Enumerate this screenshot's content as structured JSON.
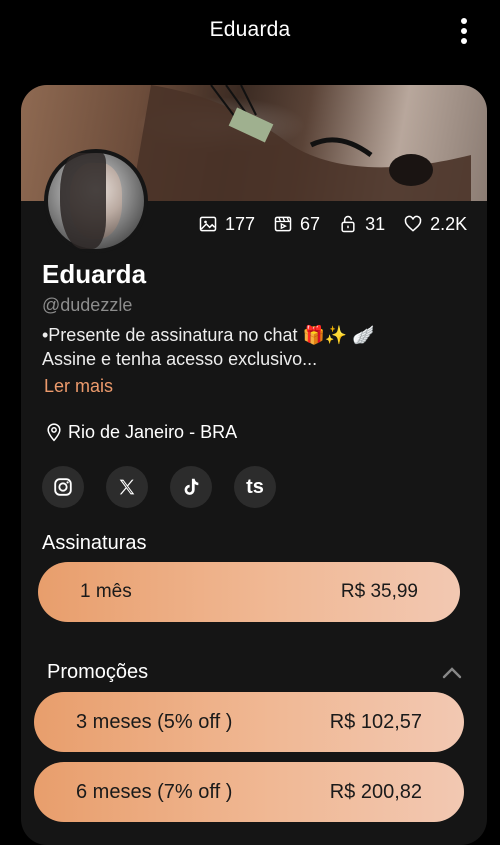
{
  "header": {
    "title": "Eduarda",
    "menu_icon": "more-vertical-icon"
  },
  "profile": {
    "name": "Eduarda",
    "handle": "@dudezzle",
    "bio_line1": "•Presente de assinatura no chat 🎁✨ 🪽",
    "bio_line2": "Assine e tenha acesso exclusivo...",
    "read_more": "Ler mais",
    "location": "Rio de Janeiro - BRA"
  },
  "stats": {
    "photos": "177",
    "videos": "67",
    "locked": "31",
    "likes": "2.2K"
  },
  "socials": [
    {
      "icon": "instagram-icon"
    },
    {
      "icon": "x-icon"
    },
    {
      "icon": "tiktok-icon"
    },
    {
      "icon": "ts-icon",
      "label": "ts"
    }
  ],
  "subscriptions": {
    "title": "Assinaturas",
    "plan": {
      "label": "1 mês",
      "price": "R$ 35,99"
    }
  },
  "promotions": {
    "title": "Promoções",
    "items": [
      {
        "label": "3 meses (5% off )",
        "price": "R$ 102,57"
      },
      {
        "label": "6 meses (7% off )",
        "price": "R$ 200,82"
      }
    ]
  },
  "colors": {
    "accent": "#ec9a6c",
    "card": "#151515",
    "background": "#000000"
  }
}
